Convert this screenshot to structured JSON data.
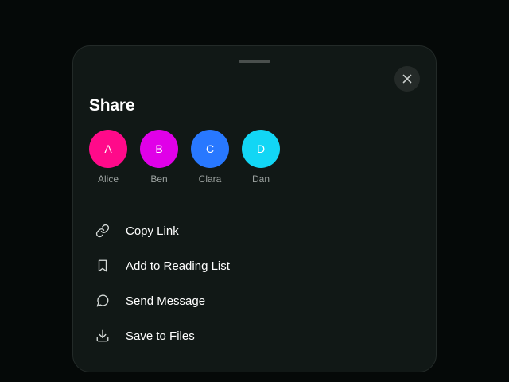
{
  "sheet": {
    "title": "Share",
    "close_icon": "close-icon",
    "background": "#111816"
  },
  "contacts": [
    {
      "initial": "A",
      "name": "Alice",
      "color": "#ff0a8a"
    },
    {
      "initial": "B",
      "name": "Ben",
      "color": "#e000e8"
    },
    {
      "initial": "C",
      "name": "Clara",
      "color": "#2878ff"
    },
    {
      "initial": "D",
      "name": "Dan",
      "color": "#12d6f5"
    }
  ],
  "actions": [
    {
      "label": "Copy Link",
      "icon": "link-icon"
    },
    {
      "label": "Add to Reading List",
      "icon": "bookmark-icon"
    },
    {
      "label": "Send Message",
      "icon": "message-icon"
    },
    {
      "label": "Save to Files",
      "icon": "download-icon"
    }
  ]
}
